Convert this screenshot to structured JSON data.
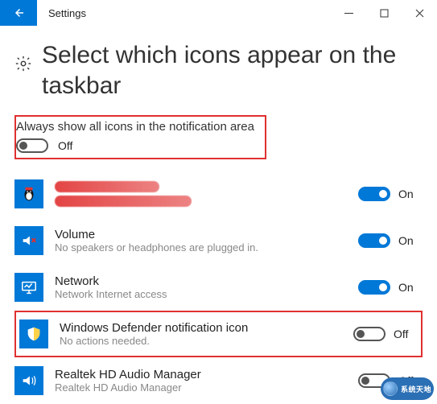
{
  "window": {
    "app_title": "Settings"
  },
  "page": {
    "title": "Select which icons appear on the taskbar"
  },
  "master": {
    "label": "Always show all icons in the notification area",
    "state_text": "Off",
    "on": false
  },
  "items": [
    {
      "title": "",
      "subtitle": "",
      "state_text": "On",
      "on": true,
      "icon": "penguin-app-icon",
      "redacted": true
    },
    {
      "title": "Volume",
      "subtitle": "No speakers or headphones are plugged in.",
      "state_text": "On",
      "on": true,
      "icon": "volume-muted-icon"
    },
    {
      "title": "Network",
      "subtitle": "Network Internet access",
      "state_text": "On",
      "on": true,
      "icon": "network-monitor-icon"
    },
    {
      "title": "Windows Defender notification icon",
      "subtitle": "No actions needed.",
      "state_text": "Off",
      "on": false,
      "icon": "shield-icon",
      "highlighted": true
    },
    {
      "title": "Realtek HD Audio Manager",
      "subtitle": "Realtek HD Audio Manager",
      "state_text": "Off",
      "on": false,
      "icon": "audio-manager-icon"
    }
  ],
  "watermark": {
    "text": "系统天地"
  }
}
